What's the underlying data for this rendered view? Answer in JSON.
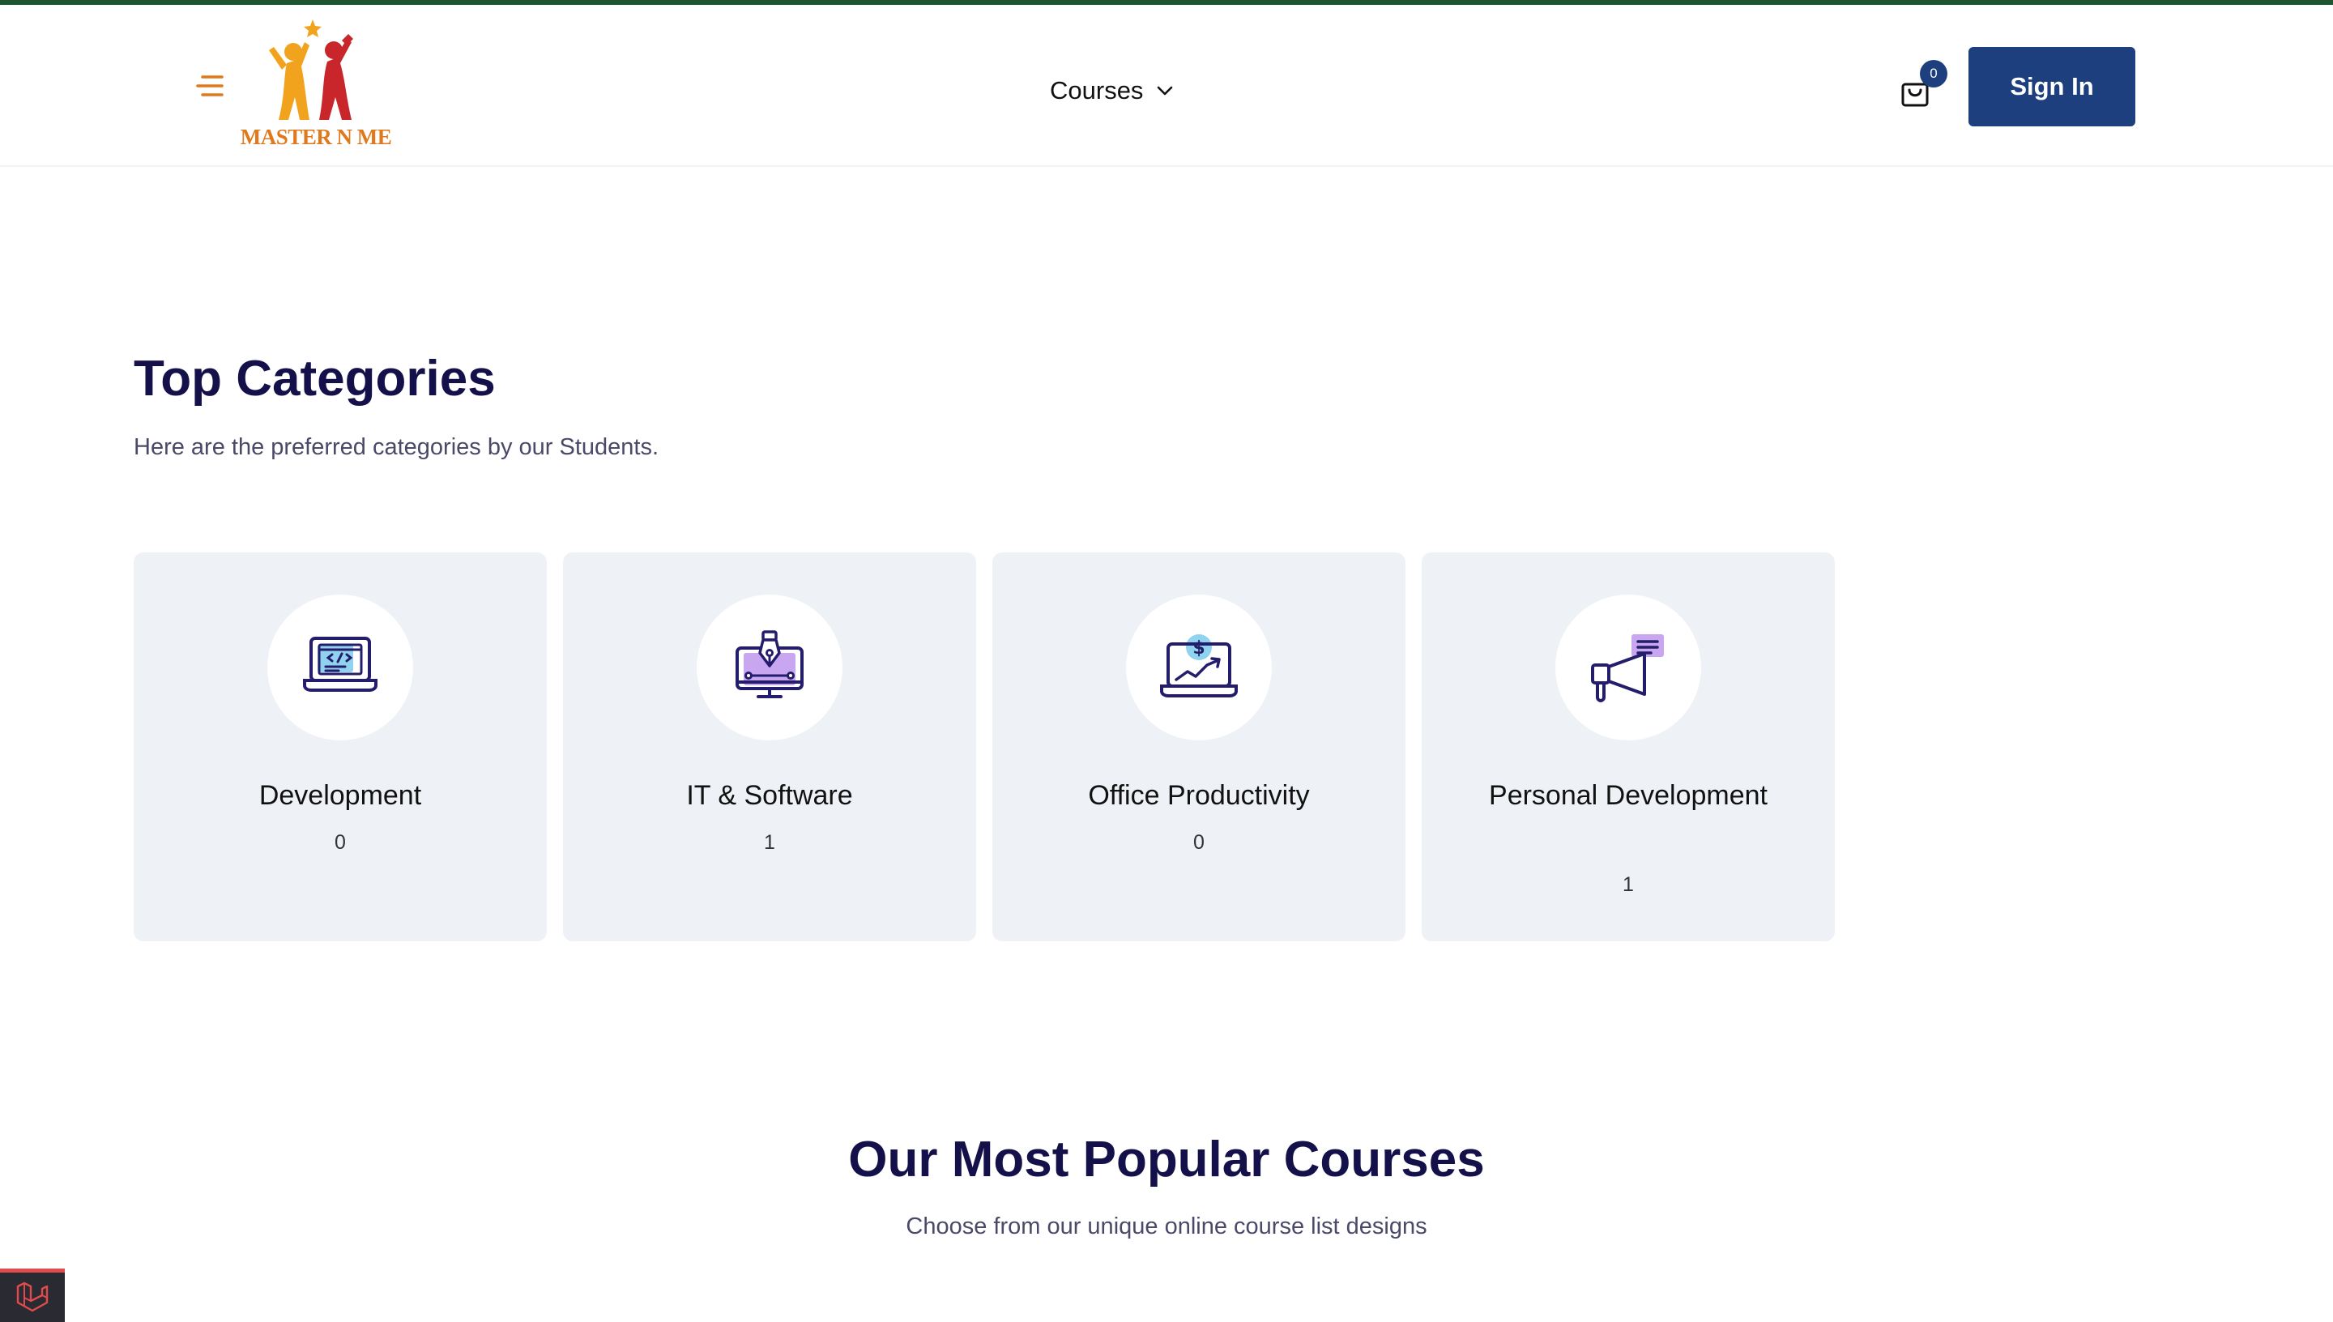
{
  "header": {
    "logo_text": "MASTER N ME",
    "nav": {
      "courses_label": "Courses"
    },
    "cart": {
      "count": "0"
    },
    "signin_label": "Sign In"
  },
  "categories": {
    "title": "Top Categories",
    "subtitle": "Here are the preferred categories by our Students.",
    "items": [
      {
        "name": "Development",
        "count": "0",
        "icon": "laptop-code-icon"
      },
      {
        "name": "IT & Software",
        "count": "1",
        "icon": "pen-tool-monitor-icon"
      },
      {
        "name": "Office Productivity",
        "count": "0",
        "icon": "laptop-dollar-chart-icon"
      },
      {
        "name": "Personal Development",
        "count": "1",
        "icon": "megaphone-icon"
      }
    ]
  },
  "popular": {
    "title": "Our Most Popular Courses",
    "subtitle": "Choose from our unique online course list designs"
  },
  "colors": {
    "top_strip": "#1e5631",
    "primary": "#1d3f7e",
    "heading": "#14104a",
    "card_bg": "#eef1f6",
    "logo_orange": "#e0781c",
    "hamburger": "#e0781c",
    "debug_accent": "#e24b4b"
  }
}
